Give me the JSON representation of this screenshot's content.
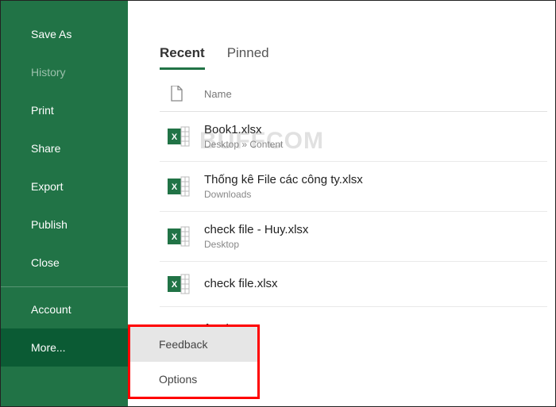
{
  "sidebar": {
    "items": [
      {
        "label": "Save As",
        "dim": false,
        "selected": false
      },
      {
        "label": "History",
        "dim": true,
        "selected": false
      },
      {
        "label": "Print",
        "dim": false,
        "selected": false
      },
      {
        "label": "Share",
        "dim": false,
        "selected": false
      },
      {
        "label": "Export",
        "dim": false,
        "selected": false
      },
      {
        "label": "Publish",
        "dim": false,
        "selected": false
      },
      {
        "label": "Close",
        "dim": false,
        "selected": false
      },
      {
        "label": "Account",
        "dim": false,
        "selected": false
      },
      {
        "label": "More...",
        "dim": false,
        "selected": true
      }
    ]
  },
  "tabs": {
    "recent": "Recent",
    "pinned": "Pinned",
    "active": "recent"
  },
  "header": {
    "name": "Name"
  },
  "files": [
    {
      "name": "Book1.xlsx",
      "path": "Desktop » Content"
    },
    {
      "name": "Thống kê File các công ty.xlsx",
      "path": "Downloads"
    },
    {
      "name": "check file - Huy.xlsx",
      "path": "Desktop"
    },
    {
      "name": "check file.xlsx",
      "path": ""
    },
    {
      "name": "ệc.xlsx",
      "path": ""
    }
  ],
  "popup": {
    "feedback": "Feedback",
    "options": "Options"
  },
  "watermark": "BUFFCOM",
  "colors": {
    "brand": "#217346",
    "highlight": "#ff0000"
  }
}
